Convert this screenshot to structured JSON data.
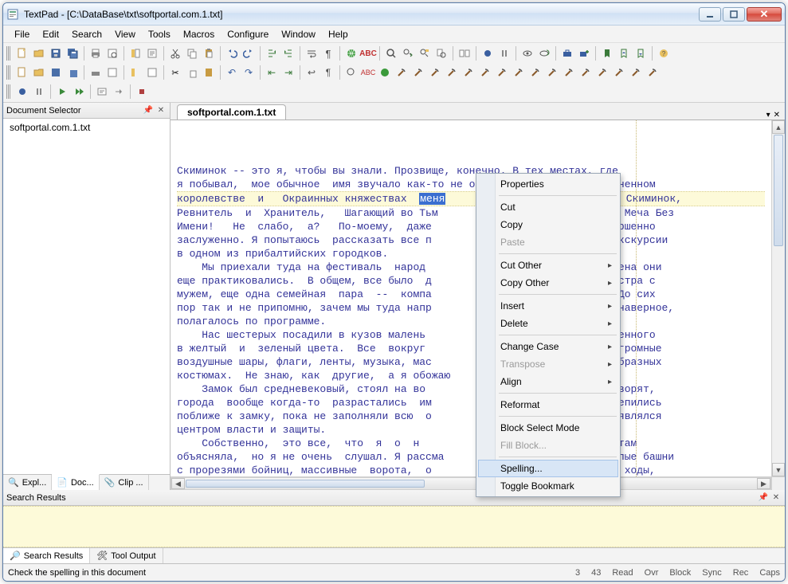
{
  "window": {
    "title": "TextPad - [C:\\DataBase\\txt\\softportal.com.1.txt]"
  },
  "menubar": [
    "File",
    "Edit",
    "Search",
    "View",
    "Tools",
    "Macros",
    "Configure",
    "Window",
    "Help"
  ],
  "panels": {
    "doc_selector": {
      "title": "Document Selector",
      "items": [
        "softportal.com.1.txt"
      ]
    },
    "tabs": {
      "explorer": "Expl...",
      "document": "Doc...",
      "clip": "Clip ..."
    },
    "search": {
      "title": "Search Results"
    },
    "bottom_tabs": {
      "search_results": "Search Results",
      "tool_output": "Tool Output"
    }
  },
  "editor": {
    "tab": "softportal.com.1.txt",
    "lines": [
      "Скиминок -- это я, чтобы вы знали. Прозвище, конечно. В тех местах, где",
      "я побывал,  мое обычное  имя звучало как-то не очень...   Зато  в Соединенном",
      "королевстве  и   Окраинных княжествах  ",
      "Ревнитель  и  Хранитель,   Шагающий во Тьм",
      "Имени!   Не  слабо,  а?   По-моему,  даже",
      "заслуженно. Я попытаюсь  рассказать все п",
      "в одном из прибалтийских городков.",
      "    Мы приехали туда на фестиваль  народ",
      "еще практиковались.  В общем, все было  д",
      "мужем, еще одна семейная  пара  --  компа",
      "пор так и не припомню, зачем мы туда напр",
      "полагалось по программе.",
      "    Нас шестерых посадили в кузов малень",
      "в желтый  и  зеленый цвета.  Все  вокруг ",
      "воздушные шары, флаги, ленты, музыка, мас",
      "костюмах.  Не знаю, как  другие,  а я обожаю",
      "    Замок был средневековый, стоял на во",
      "города  вообще когда-то  разрастались  им",
      "поближе к замку, пока не заполняли всю  о",
      "центром власти и защиты.",
      "    Собственно,  это все,  что  я  о  н",
      "объясняла,  но я не очень  слушал. Я рассма",
      "с прорезями бойниц, массивные  ворота,  о"
    ],
    "line2_sel": "меня",
    "line2_after_fragments": [
      "д   Скиминок,",
      "аф   Меча Без",
      " совершенно",
      "  с экскурсии",
      "",
      "  времена они",
      "й, сестра с",
      "кая. До сих",
      "  -- наверное,",
      "",
      "аскрашенного",
      ":   огромные",
      "азнообразных",
      "",
      "не. Говорят,",
      "а   лепились",
      "ему  являлся",
      "",
      "что-то там",
      "руглые башни",
      "ери,  ходы,"
    ]
  },
  "context_menu": {
    "properties": "Properties",
    "cut": "Cut",
    "copy": "Copy",
    "paste": "Paste",
    "cut_other": "Cut Other",
    "copy_other": "Copy Other",
    "insert": "Insert",
    "delete": "Delete",
    "change_case": "Change Case",
    "transpose": "Transpose",
    "align": "Align",
    "reformat": "Reformat",
    "block_select": "Block Select Mode",
    "fill_block": "Fill Block...",
    "spelling": "Spelling...",
    "toggle_bookmark": "Toggle Bookmark"
  },
  "status": {
    "hint": "Check the spelling in this document",
    "line": "3",
    "col": "43",
    "flags": [
      "Read",
      "Ovr",
      "Block",
      "Sync",
      "Rec",
      "Caps"
    ]
  }
}
